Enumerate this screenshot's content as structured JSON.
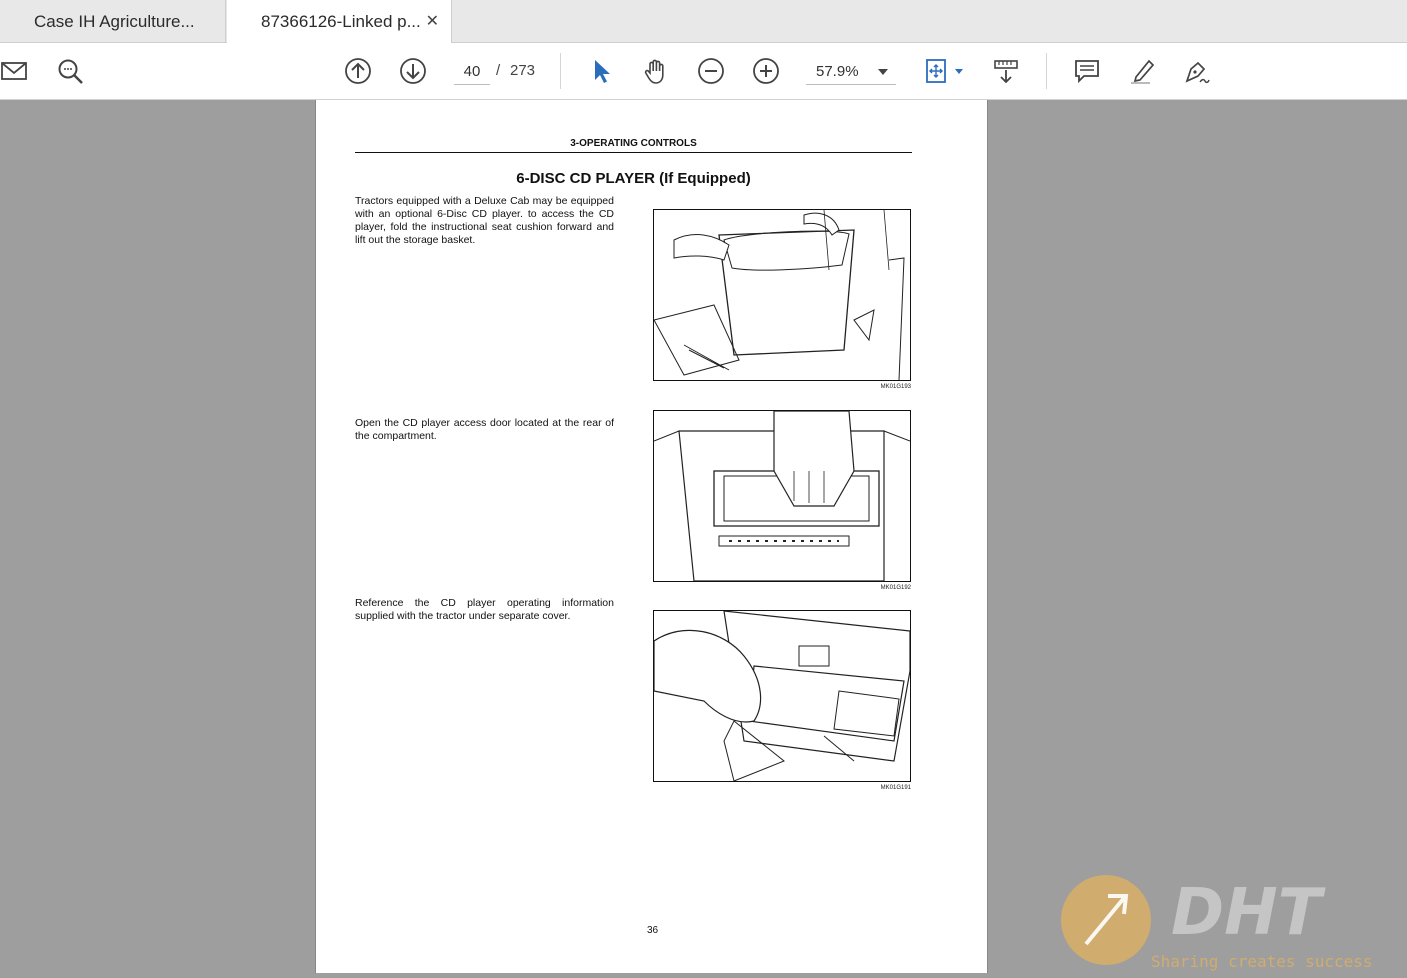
{
  "tabs": [
    {
      "label": "Case IH Agriculture..."
    },
    {
      "label": "87366126-Linked p...",
      "close": "✕"
    }
  ],
  "toolbar": {
    "current_page": "40",
    "page_separator": "/",
    "total_pages": "273",
    "zoom": "57.9%",
    "icons": [
      "mail-icon",
      "search-icon",
      "page-up-icon",
      "page-down-icon",
      "select-cursor-icon",
      "hand-tool-icon",
      "zoom-out-icon",
      "zoom-in-icon",
      "fit-page-icon",
      "scroll-mode-icon",
      "comment-icon",
      "highlight-icon",
      "sign-icon"
    ],
    "accent_color": "#2a6ebb"
  },
  "document": {
    "section_header": "3-OPERATING CONTROLS",
    "title": "6-DISC CD PLAYER (If Equipped)",
    "paragraphs": [
      "Tractors equipped with a Deluxe Cab may be equipped with an optional 6-Disc CD player. to access the CD player, fold the instructional seat cushion forward and lift out the storage basket.",
      "Open the CD player access door located at the rear of the compartment.",
      "Reference the CD player operating information supplied with the tractor under separate cover."
    ],
    "figure_captions": [
      "MK01G193",
      "MK01G192",
      "MK01G191"
    ],
    "page_number": "36"
  },
  "watermark": {
    "brand": "DHT",
    "tagline": "Sharing creates success"
  }
}
